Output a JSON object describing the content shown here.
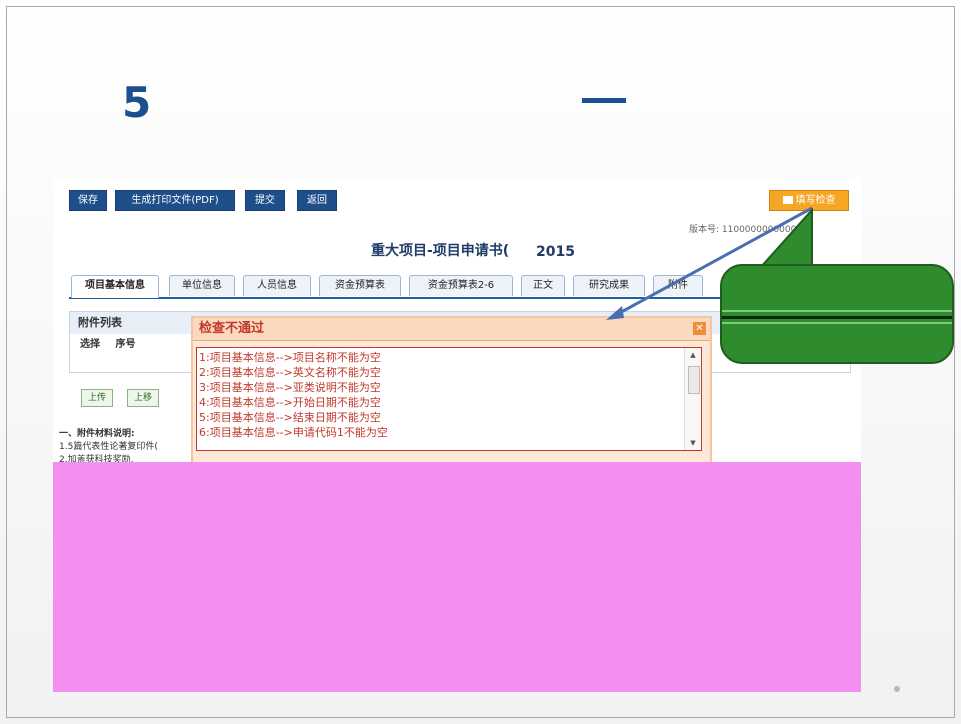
{
  "slide": {
    "number": "5",
    "dash": "—"
  },
  "toolbar": {
    "save_label": "保存",
    "generate_pdf_label": "生成打印文件(PDF)",
    "submit_label": "提交",
    "back_label": "返回",
    "check_label": "填写检查",
    "check_icon": "checklist-icon"
  },
  "document": {
    "version_label": "版本号: 110000000000001",
    "title": "重大项目-项目申请书(",
    "year": "2015"
  },
  "tabs": [
    {
      "label": "项目基本信息",
      "active": true
    },
    {
      "label": "单位信息",
      "active": false
    },
    {
      "label": "人员信息",
      "active": false
    },
    {
      "label": "资金预算表",
      "active": false
    },
    {
      "label": "资金预算表2-6",
      "active": false
    },
    {
      "label": "正文",
      "active": false
    },
    {
      "label": "研究成果",
      "active": false
    },
    {
      "label": "附件",
      "active": false
    }
  ],
  "attachments": {
    "heading": "附件列表",
    "col_select": "选择",
    "col_index": "序号",
    "upload_label": "上传",
    "move_up_label": "上移"
  },
  "notes": {
    "heading": "一、附件材料说明:",
    "line1": "1.5篇代表性论著复印件(",
    "line2": "2.加盖获科技奖励,"
  },
  "dialog": {
    "title": "检查不通过",
    "close_icon": "close-icon",
    "errors": [
      "1:项目基本信息-->项目名称不能为空",
      "2:项目基本信息-->英文名称不能为空",
      "3:项目基本信息-->亚类说明不能为空",
      "4:项目基本信息-->开始日期不能为空",
      "5:项目基本信息-->结束日期不能为空",
      "6:项目基本信息-->申请代码1不能为空"
    ]
  },
  "colors": {
    "accent": "#1f4f8a",
    "error": "#c0392b",
    "callout": "#2e8b2e",
    "corruption": "#f28ff0",
    "slide_title": "#1b4f8f"
  }
}
